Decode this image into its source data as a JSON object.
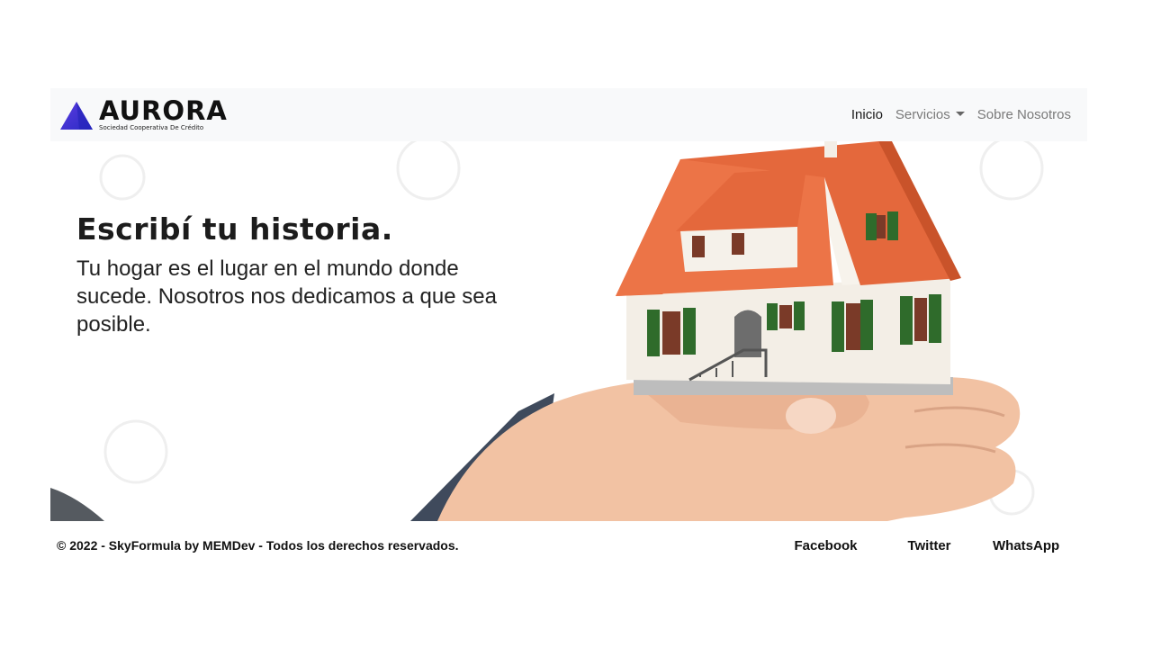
{
  "brand": {
    "name": "AURORA",
    "tagline": "Sociedad Cooperativa De Crédito",
    "logo_color": "#3d3bd6"
  },
  "nav": {
    "items": [
      {
        "label": "Inicio"
      },
      {
        "label": "Servicios"
      },
      {
        "label": "Sobre Nosotros"
      }
    ]
  },
  "hero": {
    "title": "Escribí tu historia.",
    "text": "Tu hogar es el lugar en el mundo donde sucede. Nosotros nos dedicamos a que sea posible.",
    "image_icon": "house-in-hands-image"
  },
  "footer": {
    "copyright": "© 2022 - SkyFormula by MEMDev - Todos los derechos reservados.",
    "links": [
      {
        "label": "Facebook"
      },
      {
        "label": "Twitter"
      },
      {
        "label": "WhatsApp"
      }
    ]
  },
  "colors": {
    "navbar_bg": "#f8f9fa",
    "roof": "#e4683c",
    "shutters": "#2f6b2b",
    "skin": "#f2c2a3"
  }
}
